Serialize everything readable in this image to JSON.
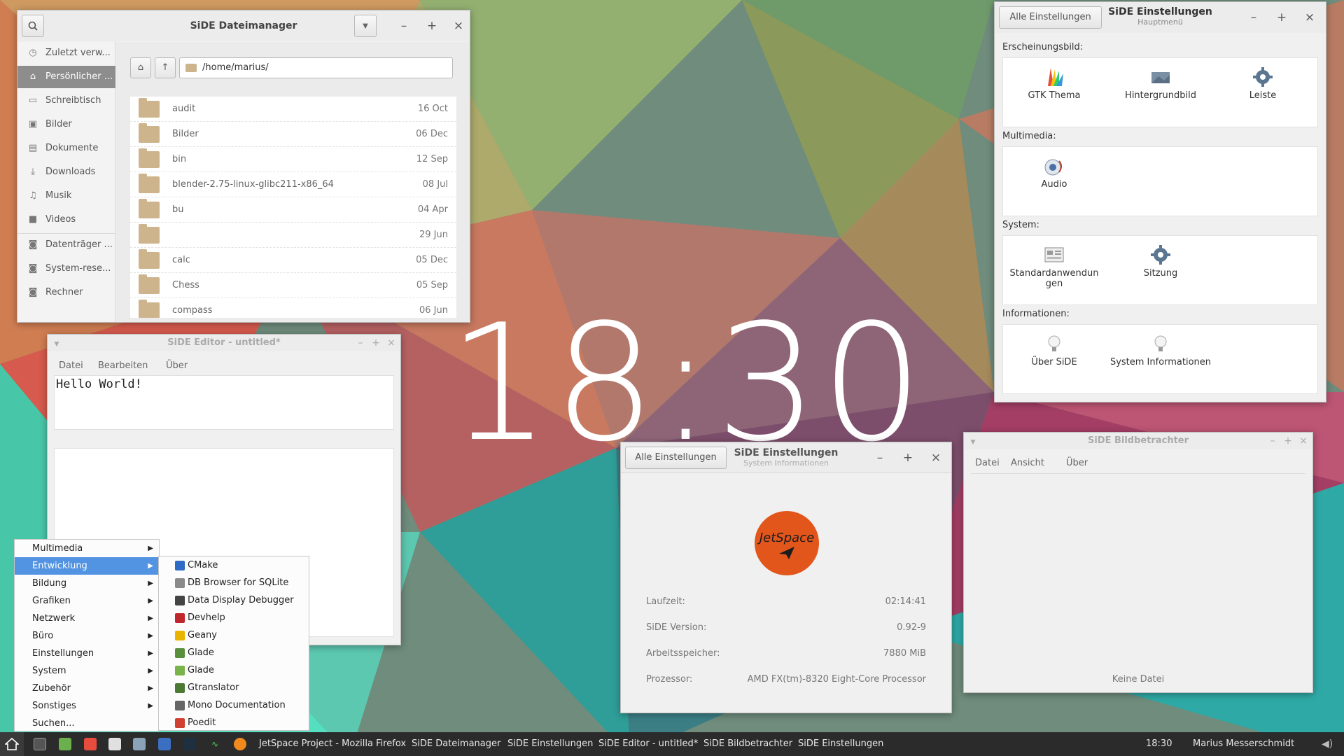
{
  "desktop": {
    "clock_time": "18:30"
  },
  "file_manager": {
    "title": "SiDE Dateimanager",
    "path": "/home/marius/",
    "sidebar": [
      {
        "label": "Zuletzt verw...",
        "icon": "clock-icon"
      },
      {
        "label": "Persönlicher ...",
        "icon": "home-icon",
        "active": true
      },
      {
        "label": "Schreibtisch",
        "icon": "desktop-icon"
      },
      {
        "label": "Bilder",
        "icon": "image-icon"
      },
      {
        "label": "Dokumente",
        "icon": "document-icon"
      },
      {
        "label": "Downloads",
        "icon": "download-icon"
      },
      {
        "label": "Musik",
        "icon": "music-icon"
      },
      {
        "label": "Videos",
        "icon": "video-icon"
      },
      {
        "label": "Datenträger ...",
        "icon": "drive-icon"
      },
      {
        "label": "System-rese...",
        "icon": "drive-icon"
      },
      {
        "label": "Rechner",
        "icon": "computer-icon"
      }
    ],
    "files": [
      {
        "name": "audit",
        "date": "16 Oct"
      },
      {
        "name": "Bilder",
        "date": "06 Dec"
      },
      {
        "name": "bin",
        "date": "12 Sep"
      },
      {
        "name": "blender-2.75-linux-glibc211-x86_64",
        "date": "08 Jul"
      },
      {
        "name": "bu",
        "date": "04 Apr"
      },
      {
        "name": "",
        "date": "29 Jun"
      },
      {
        "name": "calc",
        "date": "05 Dec"
      },
      {
        "name": "Chess",
        "date": "05 Sep"
      },
      {
        "name": "compass",
        "date": "06 Jun"
      }
    ]
  },
  "settings": {
    "title": "SiDE Einstellungen",
    "subtitle": "Hauptmenü",
    "back_button": "Alle Einstellungen",
    "sections": {
      "appearance": {
        "label": "Erscheinungsbild:",
        "items": [
          "GTK Thema",
          "Hintergrundbild",
          "Leiste"
        ]
      },
      "multimedia": {
        "label": "Multimedia:",
        "items": [
          "Audio"
        ]
      },
      "system": {
        "label": "System:",
        "items": [
          "Standardanwendun gen",
          "Sitzung"
        ]
      },
      "info": {
        "label": "Informationen:",
        "items": [
          "Über SiDE",
          "System Informationen"
        ]
      }
    }
  },
  "editor": {
    "title": "SiDE Editor - untitled*",
    "menu": [
      "Datei",
      "Bearbeiten",
      "Über"
    ],
    "content": "Hello World!"
  },
  "sysinfo": {
    "title": "SiDE Einstellungen",
    "subtitle": "System Informationen",
    "back_button": "Alle Einstellungen",
    "logo_text": "JetSpace",
    "rows": [
      {
        "key": "Laufzeit:",
        "value": "02:14:41"
      },
      {
        "key": "SiDE Version:",
        "value": "0.92-9"
      },
      {
        "key": "Arbeitsspeicher:",
        "value": "7880 MiB"
      },
      {
        "key": "Prozessor:",
        "value": "AMD FX(tm)-8320 Eight-Core Processor"
      }
    ]
  },
  "viewer": {
    "title": "SiDE Bildbetrachter",
    "menu": [
      "Datei",
      "Ansicht",
      "Über"
    ],
    "status": "Keine Datei"
  },
  "start_menu": {
    "categories": [
      "Multimedia",
      "Entwicklung",
      "Bildung",
      "Grafiken",
      "Netzwerk",
      "Büro",
      "Einstellungen",
      "System",
      "Zubehör",
      "Sonstiges",
      "Suchen..."
    ],
    "active_category": "Entwicklung",
    "submenu": [
      {
        "label": "CMake",
        "color": "#2d6bc4"
      },
      {
        "label": "DB Browser for SQLite",
        "color": "#8a8a8a"
      },
      {
        "label": "Data Display Debugger",
        "color": "#444444"
      },
      {
        "label": "Devhelp",
        "color": "#c0272d"
      },
      {
        "label": "Geany",
        "color": "#e8b400"
      },
      {
        "label": "Glade",
        "color": "#5a8f3c"
      },
      {
        "label": "Glade",
        "color": "#7bb34b"
      },
      {
        "label": "Gtranslator",
        "color": "#4c7a35"
      },
      {
        "label": "Mono Documentation",
        "color": "#666666"
      },
      {
        "label": "Poedit",
        "color": "#d04030"
      }
    ]
  },
  "taskbar": {
    "tasks": [
      "JetSpace Project - Mozilla Firefox",
      "SiDE Dateimanager",
      "SiDE Einstellungen",
      "SiDE Editor - untitled*",
      "SiDE Bildbetrachter",
      "SiDE Einstellungen"
    ],
    "time": "18:30",
    "user": "Marius Messerschmidt"
  }
}
